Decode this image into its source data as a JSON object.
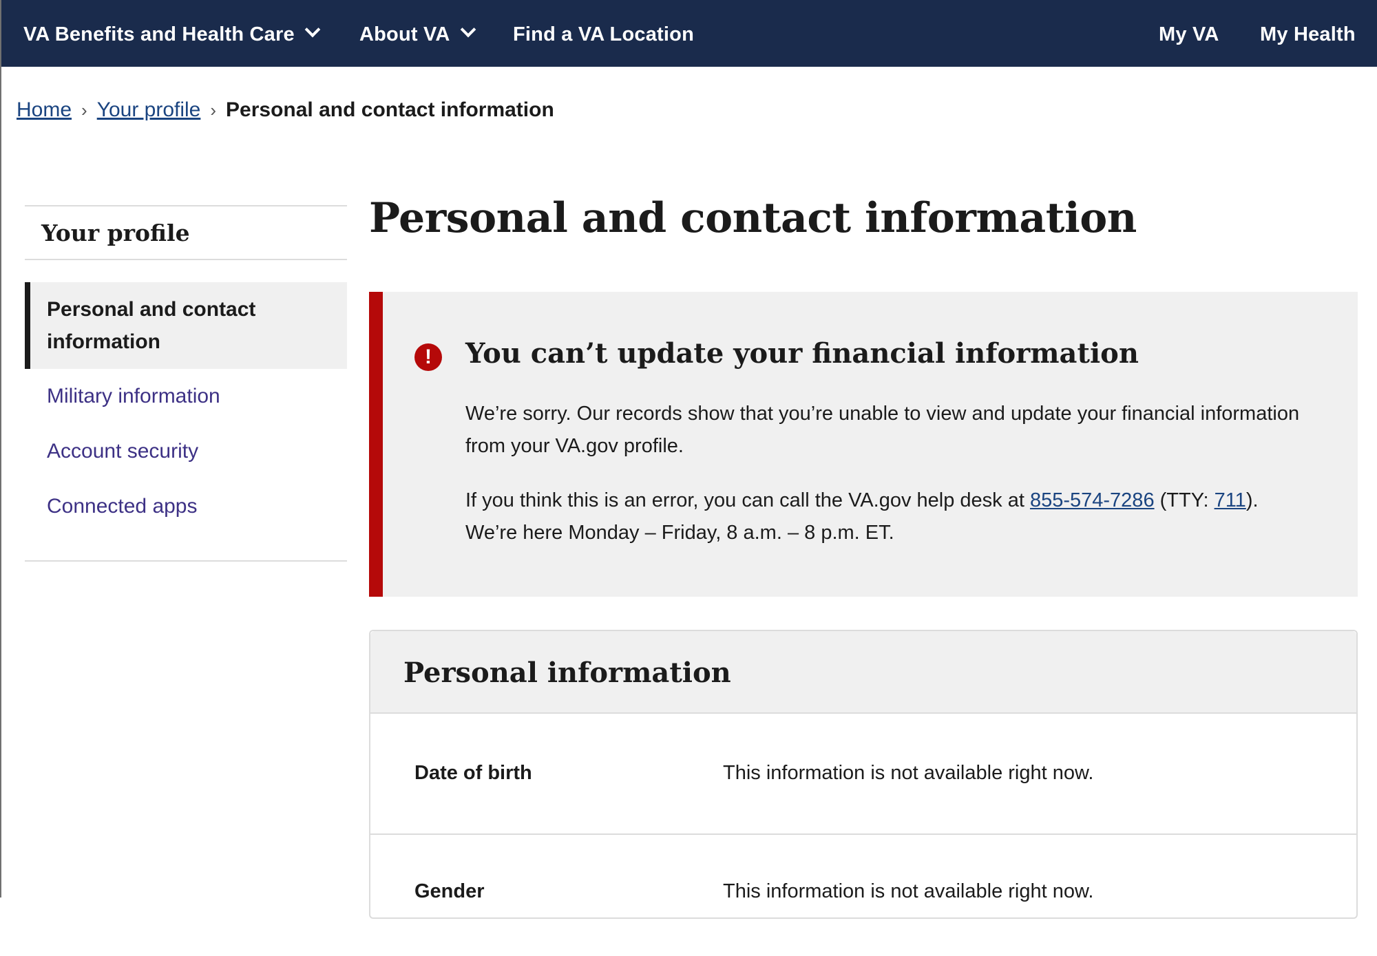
{
  "topnav": {
    "items": [
      {
        "label": "VA Benefits and Health Care"
      },
      {
        "label": "About VA"
      },
      {
        "label": "Find a VA Location"
      },
      {
        "label": "My VA"
      },
      {
        "label": "My Health"
      }
    ]
  },
  "breadcrumb": {
    "home": "Home",
    "profile": "Your profile",
    "current": "Personal and contact information",
    "separator": "›"
  },
  "sidebar": {
    "title": "Your profile",
    "items": [
      {
        "label": "Personal and contact information"
      },
      {
        "label": "Military information"
      },
      {
        "label": "Account security"
      },
      {
        "label": "Connected apps"
      }
    ]
  },
  "main": {
    "title": "Personal and contact information"
  },
  "alert": {
    "icon": "!",
    "title": "You can’t update your financial information",
    "paragraph1": "We’re sorry. Our records show that you’re unable to view and update your financial information from your VA.gov profile.",
    "p2_prefix": "If you think this is an error, you can call the VA.gov help desk at ",
    "phone": "855-574-7286",
    "p2_tty_open": " (TTY: ",
    "tty": "711",
    "p2_tty_close": ").",
    "p2_hours": "We’re here Monday – Friday, 8 a.m. – 8 p.m. ET."
  },
  "personal_info": {
    "title": "Personal information",
    "rows": [
      {
        "label": "Date of birth",
        "value": "This information is not available right now."
      },
      {
        "label": "Gender",
        "value": "This information is not available right now."
      }
    ]
  },
  "colors": {
    "nav_bg": "#1a2b4c",
    "alert_border": "#b50909",
    "link": "#1a4480",
    "sidebar_link": "#3d3185"
  }
}
